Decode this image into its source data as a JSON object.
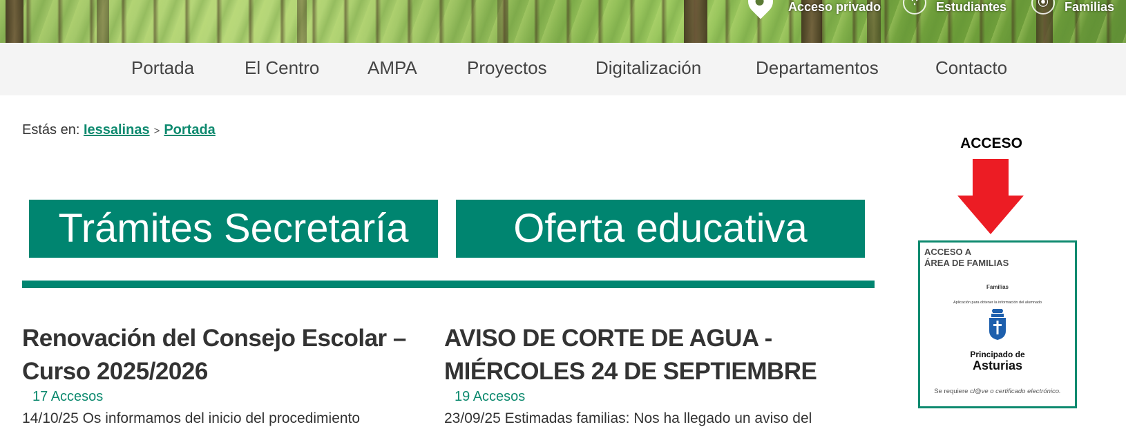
{
  "top_bar": {
    "links": [
      {
        "label": "Acceso privado",
        "icon": "map-pin-icon"
      },
      {
        "label": "Estudiantes",
        "icon": "rss-icon"
      },
      {
        "label": "Familias",
        "icon": "broadcast-icon"
      }
    ]
  },
  "nav": {
    "items": [
      "Portada",
      "El Centro",
      "AMPA",
      "Proyectos",
      "Digitalización",
      "Departamentos",
      "Contacto"
    ]
  },
  "breadcrumb": {
    "prefix": "Estás en:",
    "items": [
      "Iessalinas",
      "Portada"
    ],
    "separator": ">"
  },
  "banners": {
    "tramites": "Trámites Secretaría",
    "oferta": "Oferta educativa"
  },
  "articles": [
    {
      "title": "Renovación del Consejo Escolar – Curso 2025/2026",
      "hits": "17 Accesos",
      "intro": "14/10/25 Os informamos del inicio del procedimiento"
    },
    {
      "title": "AVISO DE CORTE DE AGUA - MIÉRCOLES 24 DE SEPTIEMBRE",
      "hits": "19 Accesos",
      "intro": "23/09/25 Estimadas familias: Nos ha llegado un aviso del"
    }
  ],
  "sidebar": {
    "heading": "ACCESO",
    "card": {
      "line1": "ACCESO A",
      "line2": "ÁREA DE FAMILIAS",
      "app_name": "Familias",
      "app_desc": "Aplicación para obtener la información del alumnado",
      "org_line1": "Principado de",
      "org_line2": "Asturias",
      "footer_prefix": "Se requiere ",
      "footer_italic": "cl@ve o certificado electrónico."
    }
  },
  "colors": {
    "accent": "#008570",
    "link": "#0e8a6f",
    "arrow": "#ec1c24",
    "nav_bg": "#f4f4f4"
  }
}
